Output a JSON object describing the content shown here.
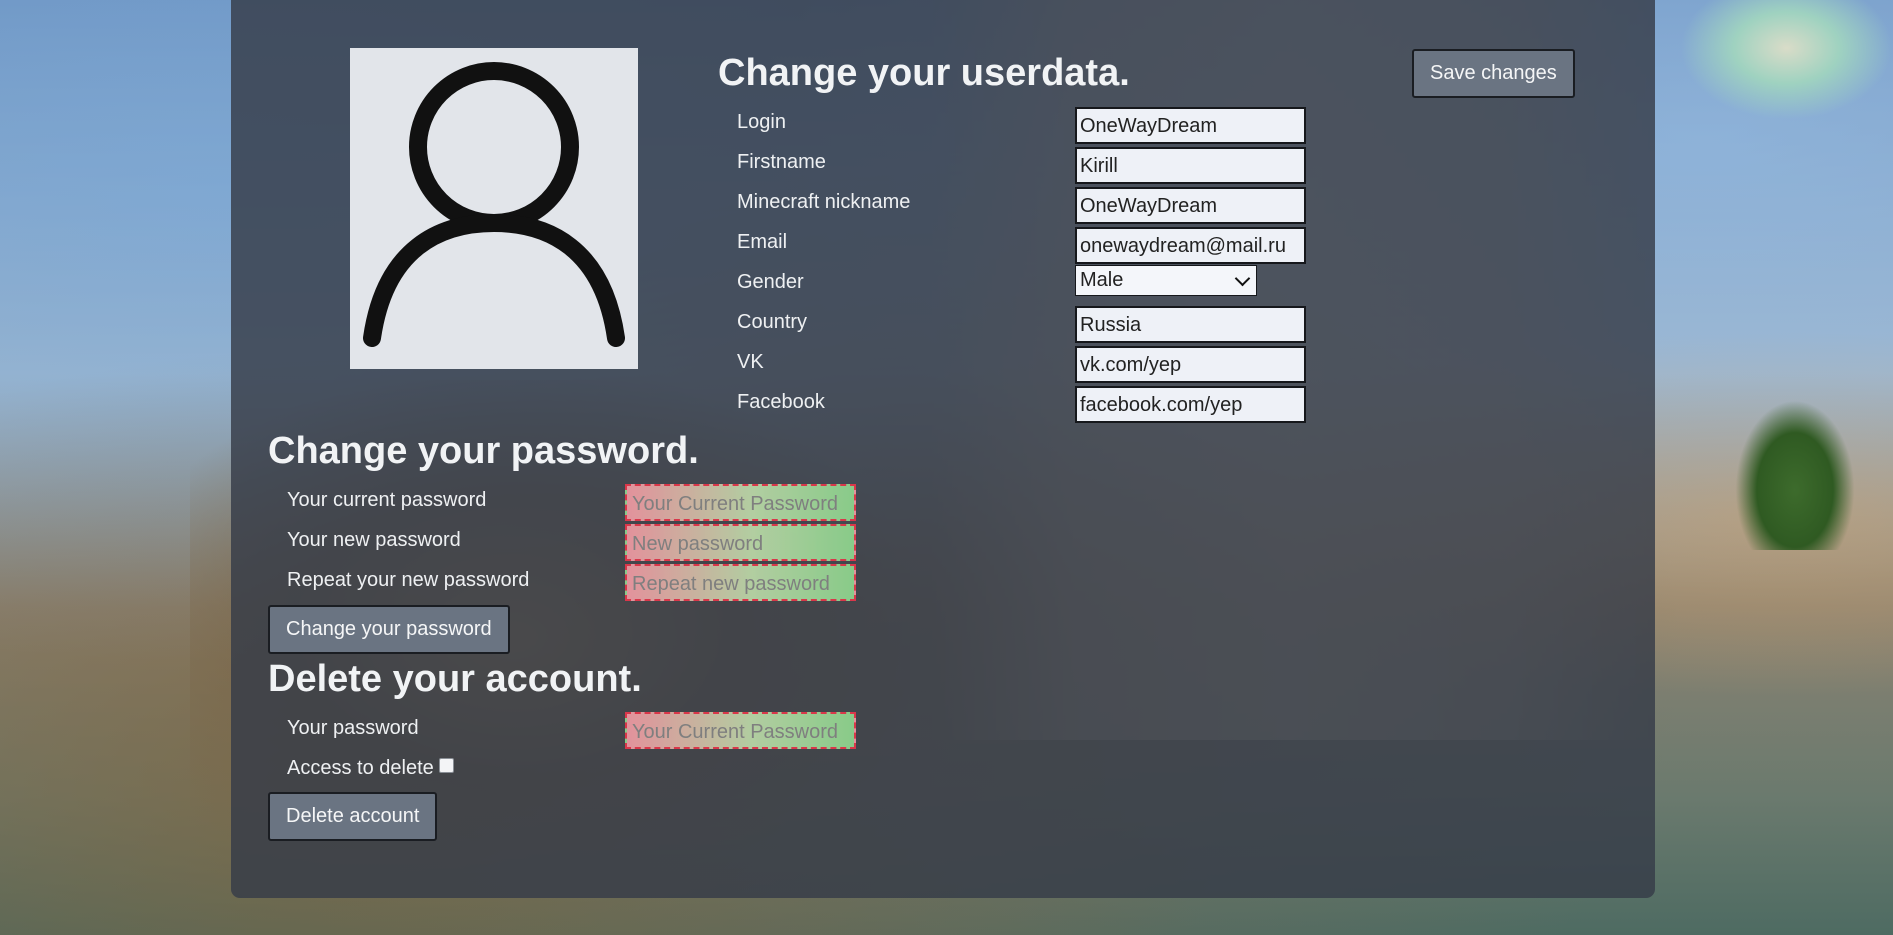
{
  "userdata": {
    "title": "Change your userdata.",
    "save_label": "Save changes",
    "fields": [
      {
        "label": "Login",
        "value": "OneWayDream"
      },
      {
        "label": "Firstname",
        "value": "Kirill"
      },
      {
        "label": "Minecraft nickname",
        "value": "OneWayDream"
      },
      {
        "label": "Email",
        "value": "onewaydream@mail.ru"
      },
      {
        "label": "Gender",
        "value": "Male"
      },
      {
        "label": "Country",
        "value": "Russia"
      },
      {
        "label": "VK",
        "value": "vk.com/yep"
      },
      {
        "label": "Facebook",
        "value": "facebook.com/yep"
      }
    ]
  },
  "password": {
    "title": "Change your password.",
    "current_label": "Your current password",
    "current_placeholder": "Your Current Password",
    "new_label": "Your new password",
    "new_placeholder": "New password",
    "repeat_label": "Repeat your new password",
    "repeat_placeholder": "Repeat new password",
    "button_label": "Change your password"
  },
  "delete": {
    "title": "Delete your account.",
    "password_label": "Your password",
    "password_placeholder": "Your Current Password",
    "access_label": "Access to delete",
    "access_checked": false,
    "button_label": "Delete account"
  },
  "colors": {
    "panel": "#363c48",
    "invalid_border": "#d9374a",
    "button": "#6a7482"
  },
  "icons": {
    "avatar": "user-silhouette-icon"
  }
}
